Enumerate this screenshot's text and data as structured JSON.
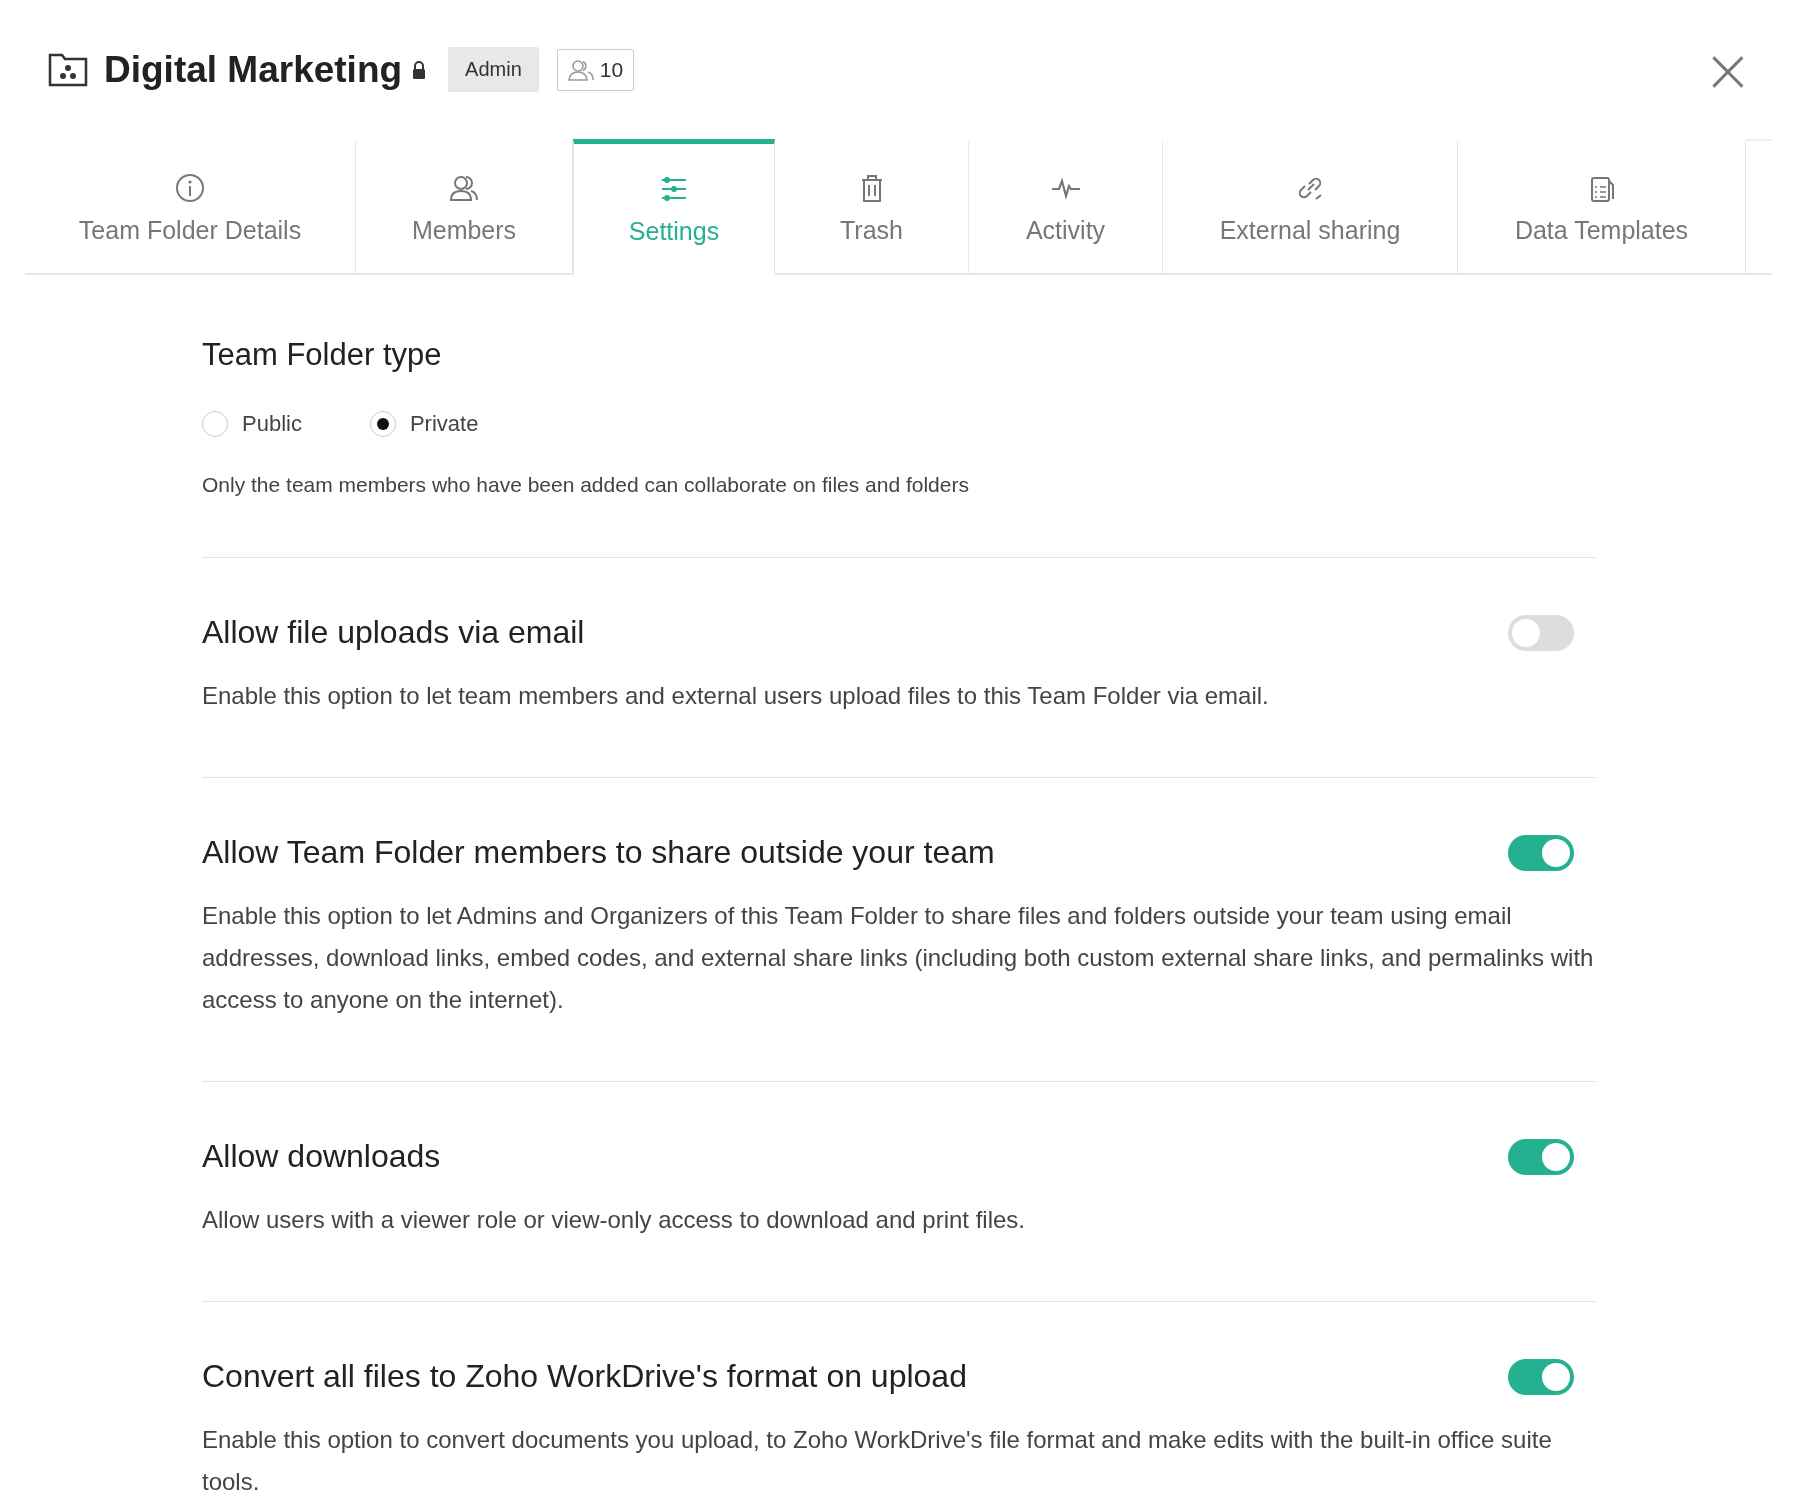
{
  "header": {
    "title": "Digital Marketing",
    "role": "Admin",
    "member_count": "10",
    "close": "×"
  },
  "tabs": [
    {
      "label": "Team Folder Details",
      "kind": "info",
      "selected": false
    },
    {
      "label": "Members",
      "kind": "members",
      "selected": false
    },
    {
      "label": "Settings",
      "kind": "settings",
      "selected": true
    },
    {
      "label": "Trash",
      "kind": "trash",
      "selected": false
    },
    {
      "label": "Activity",
      "kind": "activity",
      "selected": false
    },
    {
      "label": "External sharing",
      "kind": "link",
      "selected": false
    },
    {
      "label": "Data Templates",
      "kind": "templates",
      "selected": false
    }
  ],
  "folder_type": {
    "title": "Team Folder type",
    "options": [
      {
        "label": "Public",
        "selected": false
      },
      {
        "label": "Private",
        "selected": true
      }
    ],
    "description": "Only the team members who have been added can collaborate on files and folders"
  },
  "settings": [
    {
      "title": "Allow file uploads via email",
      "on": false,
      "description": "Enable this option to let team members and external users upload files to this Team Folder via email."
    },
    {
      "title": "Allow Team Folder members to share outside your team",
      "on": true,
      "description": "Enable this option to let Admins and Organizers of this Team Folder to share files and folders outside your team using email addresses, download links, embed codes, and external share links (including both custom external share links, and permalinks with access to anyone on the internet)."
    },
    {
      "title": "Allow downloads",
      "on": true,
      "description": "Allow users with a viewer role or view-only access to download and print files."
    },
    {
      "title": "Convert all files to Zoho WorkDrive's format on upload",
      "on": true,
      "description": "Enable this option to convert documents you upload, to Zoho WorkDrive's file format and make edits with the built-in office suite tools."
    }
  ]
}
